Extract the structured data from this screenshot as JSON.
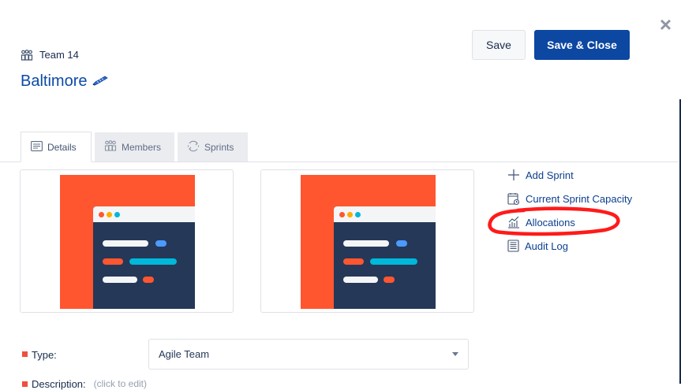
{
  "header": {
    "team_label": "Team 14",
    "title": "Baltimore",
    "save_label": "Save",
    "save_close_label": "Save & Close",
    "close_glyph": "×"
  },
  "icons": {
    "team": "team-icon",
    "edit": "pencil-icon",
    "details": "document-icon",
    "members": "team-icon",
    "sprints": "cycle-icon",
    "add_sprint": "plus-icon",
    "capacity": "calendar-clock-icon",
    "allocations": "bar-chart-icon",
    "audit": "list-icon"
  },
  "tabs": [
    {
      "label": "Details",
      "active": true
    },
    {
      "label": "Members",
      "active": false
    },
    {
      "label": "Sprints",
      "active": false
    }
  ],
  "actions": [
    {
      "label": "Add Sprint"
    },
    {
      "label": "Current Sprint Capacity"
    },
    {
      "label": "Allocations"
    },
    {
      "label": "Audit Log"
    }
  ],
  "form": {
    "type_label": "Type:",
    "type_value": "Agile Team",
    "description_label": "Description:",
    "description_hint": "(click to edit)"
  },
  "colors": {
    "primary": "#0c47a1",
    "title_blue": "#0c4aa6",
    "thumbnail_bg": "#ff5630",
    "thumbnail_panel": "#253858",
    "required_marker": "#f04e3e",
    "annotation": "#ff1a1a"
  }
}
